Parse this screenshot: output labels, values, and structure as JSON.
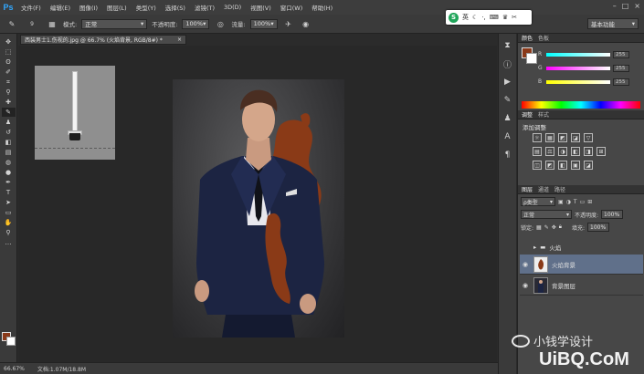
{
  "app": {
    "logo": "Ps"
  },
  "menu": [
    "文件(F)",
    "编辑(E)",
    "图像(I)",
    "图层(L)",
    "类型(Y)",
    "选择(S)",
    "滤镜(T)",
    "3D(D)",
    "视图(V)",
    "窗口(W)",
    "帮助(H)"
  ],
  "window_controls": {
    "minimize": "–",
    "maximize": "□",
    "close": "×"
  },
  "ime": {
    "logo": "S",
    "mode": "英",
    "icons": [
      "☾",
      "·,",
      "⌨",
      "♛",
      "✂"
    ]
  },
  "options": {
    "brush_size": "9",
    "mode_label": "模式:",
    "mode_value": "正常",
    "opacity_label": "不透明度:",
    "opacity_value": "100%",
    "flow_label": "流量:",
    "flow_value": "100%"
  },
  "workspace": {
    "value": "基本功能"
  },
  "document": {
    "tab_title": "西装男士1.伤视的.jpg @ 66.7% (火焰背景, RGB/8#) *",
    "close": "×"
  },
  "status": {
    "zoom": "66.67%",
    "doc_size": "文档:1.07M/18.8M"
  },
  "color_panel": {
    "tabs": [
      "颜色",
      "色板"
    ],
    "fg_color": "#8a3a1a",
    "bg_color": "#ffffff",
    "sliders": [
      {
        "label": "R",
        "value": "255"
      },
      {
        "label": "G",
        "value": "255"
      },
      {
        "label": "B",
        "value": "255"
      }
    ]
  },
  "adjust_panel": {
    "tabs": [
      "调整",
      "样式"
    ],
    "title": "添加调整",
    "icons": [
      "☼",
      "▦",
      "◩",
      "◪",
      "▽",
      "",
      "",
      "",
      "▤",
      "⚖",
      "◑",
      "◧",
      "◨",
      "⊞",
      "",
      "",
      "◫",
      "◩",
      "◧",
      "▣",
      "◪",
      "",
      "",
      ""
    ]
  },
  "layers_panel": {
    "tabs": [
      "图层",
      "通道",
      "路径"
    ],
    "filter_label": "ρ类型",
    "blend_mode": "正常",
    "opacity_label": "不透明度:",
    "opacity_value": "100%",
    "lock_label": "锁定:",
    "fill_label": "填充:",
    "fill_value": "100%",
    "layers": [
      {
        "name": "火焰",
        "kind": "group"
      },
      {
        "name": "火焰背景",
        "kind": "layer",
        "selected": true
      },
      {
        "name": "背景图层",
        "kind": "layer",
        "selected": false
      }
    ]
  },
  "watermark": {
    "text": "小钱学设计",
    "site": "UiBQ.CoM"
  }
}
